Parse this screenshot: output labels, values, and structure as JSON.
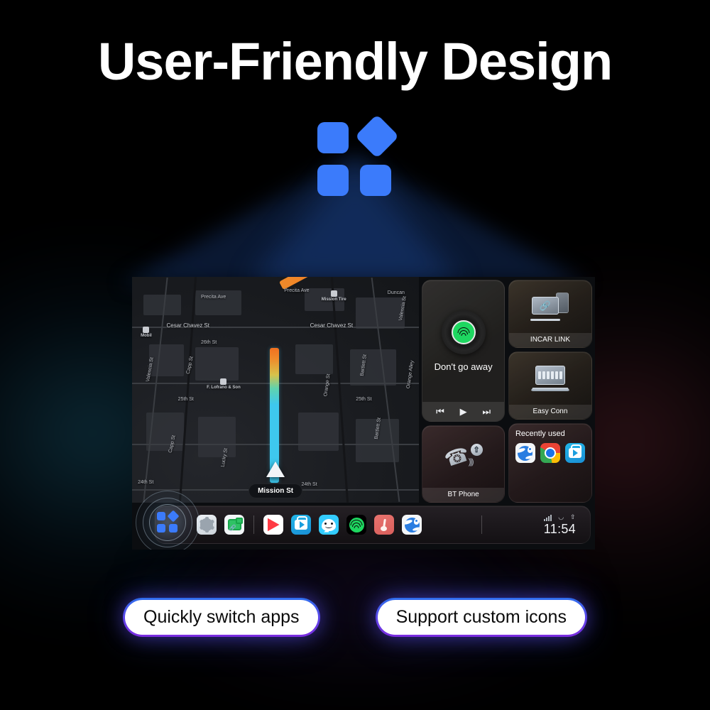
{
  "page": {
    "title": "User-Friendly Design"
  },
  "hero_logo": {
    "name": "app-grid-logo",
    "color": "#3b7bfb",
    "shapes": [
      "square",
      "diamond",
      "square",
      "square"
    ]
  },
  "car_screen": {
    "map": {
      "current_street": "Mission St",
      "street_labels": [
        "Precita Ave",
        "Precita Ave",
        "Cesar Chavez St",
        "Cesar Chavez St",
        "26th St",
        "25th St",
        "25th St",
        "24th St",
        "24th St",
        "Capp St",
        "Capp St",
        "Bartlett St",
        "Bartlett St",
        "Valencia St",
        "Valencia St",
        "Orange Alley",
        "Orange St",
        "Lucky St",
        "Duncan"
      ],
      "pois": [
        {
          "name": "Mobil"
        },
        {
          "name": "Mission Tire"
        },
        {
          "name": "F. Lofrano & Son"
        }
      ]
    },
    "music_widget": {
      "app": "spotify",
      "track_title": "Don't go away",
      "controls": {
        "previous": "⏮",
        "play": "▶",
        "next": "⏭"
      }
    },
    "tiles": [
      {
        "id": "incar-link",
        "label": "INCAR LINK",
        "icon": "screen-phone-link-icon"
      },
      {
        "id": "easy-conn",
        "label": "Easy Conn",
        "icon": "laptop-icon"
      },
      {
        "id": "bt-phone",
        "label": "BT Phone",
        "icon": "bluetooth-handset-icon"
      }
    ],
    "recently_used": {
      "title": "Recently used",
      "apps": [
        "maps",
        "chrome",
        "tv"
      ]
    },
    "dock": {
      "highlighted_app": "app-grid",
      "apps": [
        {
          "id": "app-grid",
          "icon": "app-grid-icon"
        },
        {
          "id": "settings",
          "icon": "gear-icon"
        },
        {
          "id": "screen-link",
          "icon": "screen-link-icon"
        },
        {
          "id": "play-store",
          "icon": "play-store-icon"
        },
        {
          "id": "tv",
          "icon": "tv-icon"
        },
        {
          "id": "waze",
          "icon": "waze-icon"
        },
        {
          "id": "spotify",
          "icon": "spotify-icon"
        },
        {
          "id": "music",
          "icon": "music-note-icon"
        },
        {
          "id": "maps",
          "icon": "maps-icon"
        }
      ],
      "status": {
        "signal": "signal-bars-icon",
        "wifi": "wifi-icon",
        "bluetooth": "bluetooth-icon",
        "time": "11:54"
      }
    }
  },
  "captions": [
    {
      "id": "quickly-switch-apps",
      "label": "Quickly switch apps"
    },
    {
      "id": "support-custom-icons",
      "label": "Support custom icons"
    }
  ],
  "colors": {
    "accent_blue": "#3b7bfb",
    "pill_gradient_start": "#2f6fee",
    "pill_gradient_end": "#7c2ce0",
    "background": "#000000"
  }
}
